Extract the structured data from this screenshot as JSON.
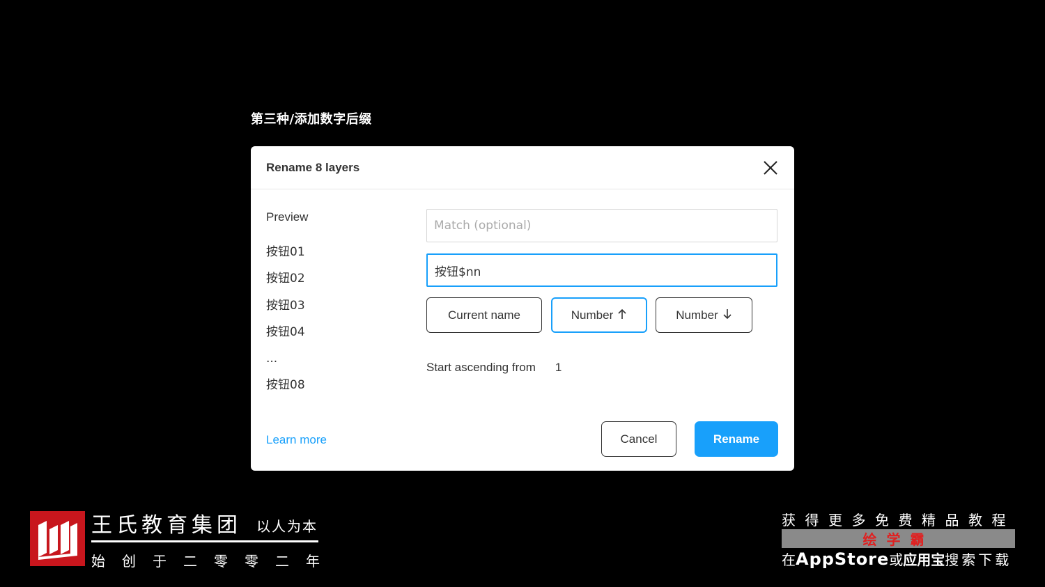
{
  "caption": "第三种/添加数字后缀",
  "dialog": {
    "title": "Rename 8 layers",
    "close_icon": "close-icon",
    "preview_label": "Preview",
    "preview_items": [
      "按钮01",
      "按钮02",
      "按钮03",
      "按钮04",
      "...",
      "按钮08"
    ],
    "match_placeholder": "Match (optional)",
    "match_value": "",
    "pattern_value": "按钮$nn",
    "chips": {
      "current_name": "Current name",
      "number_up": "Number",
      "number_up_icon": "arrow-up-icon",
      "number_down": "Number",
      "number_down_icon": "arrow-down-icon"
    },
    "start_label": "Start ascending from",
    "start_value": "1",
    "learn_more": "Learn more",
    "cancel": "Cancel",
    "rename": "Rename",
    "accent_color": "#18a0fb"
  },
  "branding": {
    "name": "王氏教育集团",
    "motto": "以人为本",
    "since": "始创于二零零二年",
    "logo_color": "#c8161d"
  },
  "promo": {
    "top": "获得更多免费精品教程",
    "band": "绘学霸",
    "bottom_prefix": "在",
    "bottom_store": "AppStore",
    "bottom_or": "或",
    "bottom_app": "应用宝",
    "bottom_suffix": "搜索下载"
  }
}
